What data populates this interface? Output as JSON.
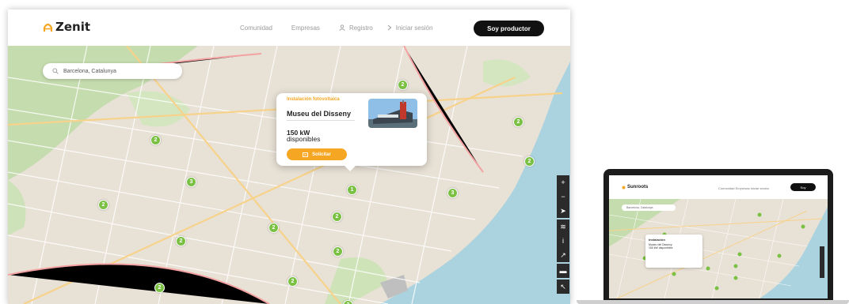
{
  "brand": {
    "name": "Zenit",
    "accent": "#f5a623"
  },
  "nav": {
    "community": "Comunidad",
    "companies": "Empresas",
    "register": "Registro",
    "login": "Iniciar sesión",
    "producer_button": "Soy productor"
  },
  "search": {
    "value": "Barcelona, Catalunya"
  },
  "popup": {
    "type": "Instalación fotovoltaica",
    "name": "Museu del Disseny",
    "power": "150 kW",
    "available": "disponibles",
    "button": "Solicitar"
  },
  "markers": [
    "2",
    "2",
    "2",
    "3",
    "2",
    "2",
    "1",
    "3",
    "2",
    "2",
    "2",
    "2",
    "2",
    "2",
    "2",
    "2"
  ],
  "map_controls": {
    "zoom_in": "+",
    "zoom_out": "−",
    "locate": "➤",
    "layers": "≋",
    "info": "i",
    "share": "↗",
    "comment": "▬",
    "cursor": "↖"
  },
  "colors": {
    "marker": "#7ac143",
    "sea": "#aad3df",
    "park": "#c8dfb0",
    "button_dark": "#111111"
  },
  "laptop": {
    "brand": "Sunroots",
    "links": "Comunidad   Empresas   Iniciar sesión",
    "button": "Soy",
    "search": "Barcelona, Catalunya",
    "popup_title": "Instalación",
    "popup_name": "Museu del Disseny",
    "popup_power": "150 kW disponibles"
  }
}
